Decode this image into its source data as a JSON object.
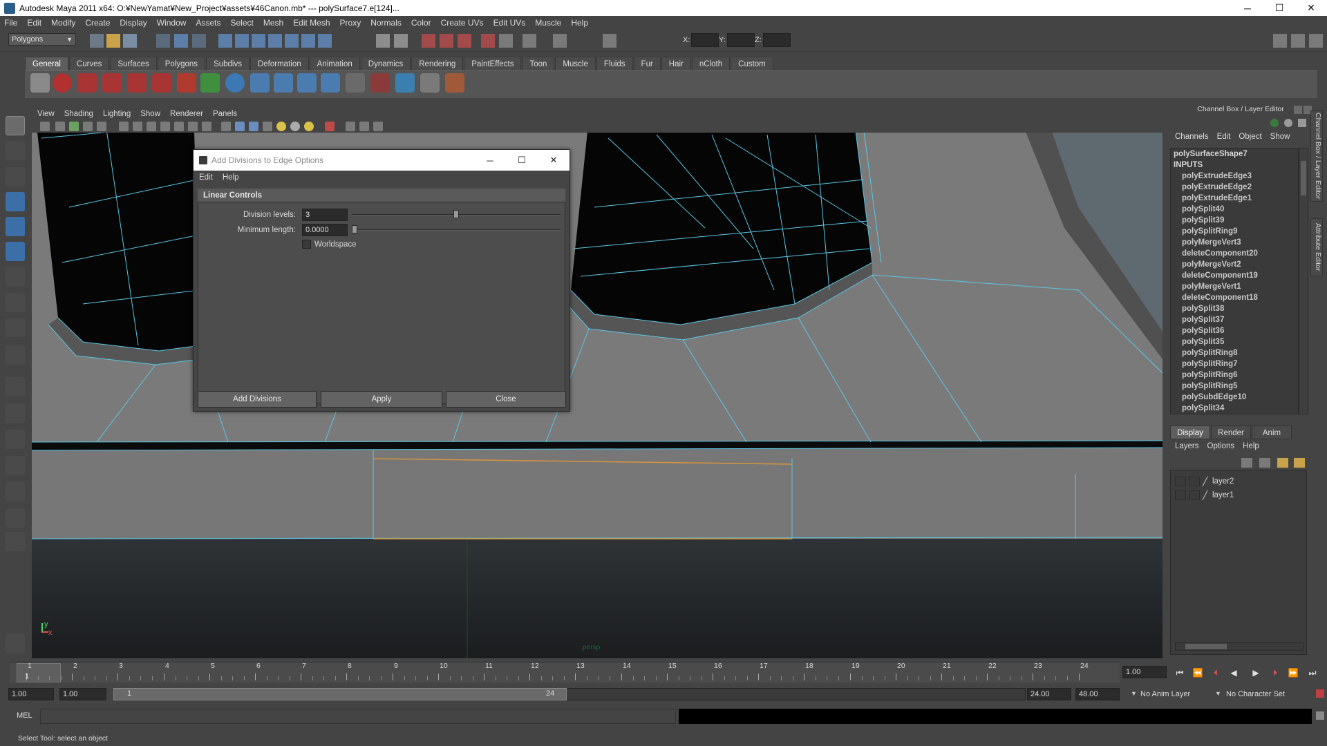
{
  "window": {
    "title": "Autodesk Maya 2011 x64: O:¥NewYamat¥New_Project¥assets¥46Canon.mb*  ---  polySurface7.e[124]...",
    "minimize": "─",
    "maximize": "☐",
    "close": "✕"
  },
  "menubar": [
    "File",
    "Edit",
    "Modify",
    "Create",
    "Display",
    "Window",
    "Assets",
    "Select",
    "Mesh",
    "Edit Mesh",
    "Proxy",
    "Normals",
    "Color",
    "Create UVs",
    "Edit UVs",
    "Muscle",
    "Help"
  ],
  "statusline": {
    "mode": "Polygons",
    "x_label": "X:",
    "y_label": "Y:",
    "z_label": "Z:"
  },
  "shelf": {
    "tabs": [
      "General",
      "Curves",
      "Surfaces",
      "Polygons",
      "Subdivs",
      "Deformation",
      "Animation",
      "Dynamics",
      "Rendering",
      "PaintEffects",
      "Toon",
      "Muscle",
      "Fluids",
      "Fur",
      "Hair",
      "nCloth",
      "Custom"
    ],
    "active_tab": "General"
  },
  "viewport": {
    "menu": [
      "View",
      "Shading",
      "Lighting",
      "Show",
      "Renderer",
      "Panels"
    ],
    "camera_label": "persp",
    "axis_y": "y",
    "axis_x": "x"
  },
  "dialog": {
    "title": "Add Divisions to Edge Options",
    "menu": [
      "Edit",
      "Help"
    ],
    "section": "Linear Controls",
    "division_levels_label": "Division levels:",
    "division_levels_value": "3",
    "division_levels_slider": 0.5,
    "minimum_length_label": "Minimum length:",
    "minimum_length_value": "0.0000",
    "minimum_length_slider": 0.0,
    "worldspace_label": "Worldspace",
    "worldspace_checked": false,
    "buttons": {
      "add": "Add Divisions",
      "apply": "Apply",
      "close": "Close"
    }
  },
  "channel_box": {
    "title": "Channel Box / Layer Editor",
    "menu": [
      "Channels",
      "Edit",
      "Object",
      "Show"
    ],
    "shape": "polySurfaceShape7",
    "inputs_header": "INPUTS",
    "inputs": [
      "polyExtrudeEdge3",
      "polyExtrudeEdge2",
      "polyExtrudeEdge1",
      "polySplit40",
      "polySplit39",
      "polySplitRing9",
      "polyMergeVert3",
      "deleteComponent20",
      "polyMergeVert2",
      "deleteComponent19",
      "polyMergeVert1",
      "deleteComponent18",
      "polySplit38",
      "polySplit37",
      "polySplit36",
      "polySplit35",
      "polySplitRing8",
      "polySplitRing7",
      "polySplitRing6",
      "polySplitRing5",
      "polySubdEdge10",
      "polySplit34"
    ]
  },
  "side_tabs": [
    "Channel Box / Layer Editor",
    "Attribute Editor"
  ],
  "layer_editor": {
    "tabs": [
      "Display",
      "Render",
      "Anim"
    ],
    "active_tab": "Display",
    "menu": [
      "Layers",
      "Options",
      "Help"
    ],
    "layers": [
      "layer2",
      "layer1"
    ]
  },
  "timeline": {
    "ticks": [
      "1",
      "2",
      "3",
      "4",
      "5",
      "6",
      "7",
      "8",
      "9",
      "10",
      "11",
      "12",
      "13",
      "14",
      "15",
      "16",
      "17",
      "18",
      "19",
      "20",
      "21",
      "22",
      "23",
      "24"
    ],
    "current_frame": "1",
    "current_time": "1.00"
  },
  "range": {
    "start_time": "1.00",
    "playback_start": "1.00",
    "range_start_label": "1",
    "range_end_label": "24",
    "playback_end": "24.00",
    "end_time": "48.00",
    "anim_layer": "No Anim Layer",
    "character_set": "No Character Set"
  },
  "command_line": {
    "label": "MEL"
  },
  "help_line": {
    "text": "Select Tool: select an object"
  },
  "colors": {
    "wire": "#5ac8e6",
    "selected_edge": "#d8953b",
    "panel": "#444444"
  }
}
